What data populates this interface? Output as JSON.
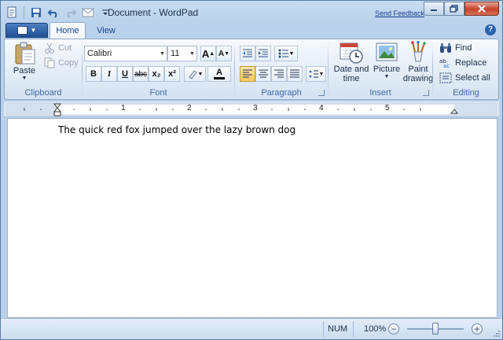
{
  "window": {
    "title": "Document - WordPad",
    "send_feedback": "Send Feedback"
  },
  "tabs": [
    {
      "label": "Home"
    },
    {
      "label": "View"
    }
  ],
  "help": "?",
  "clipboard": {
    "group_label": "Clipboard",
    "paste": "Paste",
    "cut": "Cut",
    "copy": "Copy"
  },
  "font": {
    "group_label": "Font",
    "family": "Calibri",
    "size": "11",
    "bold": "B",
    "italic": "I",
    "underline": "U",
    "strike": "abc",
    "subscript": "x₂",
    "superscript": "x²",
    "grow": "A",
    "shrink": "A",
    "color": "A"
  },
  "paragraph": {
    "group_label": "Paragraph"
  },
  "insert": {
    "group_label": "Insert",
    "datetime_line1": "Date and",
    "datetime_line2": "time",
    "picture": "Picture",
    "paint_line1": "Paint",
    "paint_line2": "drawing"
  },
  "editing": {
    "group_label": "Editing",
    "find": "Find",
    "replace": "Replace",
    "select_all": "Select all"
  },
  "ruler": {
    "numbers": [
      "1",
      "2",
      "3",
      "4",
      "5"
    ]
  },
  "document": {
    "text": "The quick red fox jumped over the lazy brown dog"
  },
  "status": {
    "num": "NUM",
    "zoom": "100%",
    "zoom_out": "−",
    "zoom_in": "+"
  },
  "colors": {
    "accent": "#15428b",
    "ribbon_bg": "#dfe9f5",
    "frame": "#b9d1ea",
    "close_button": "#c4432a"
  }
}
